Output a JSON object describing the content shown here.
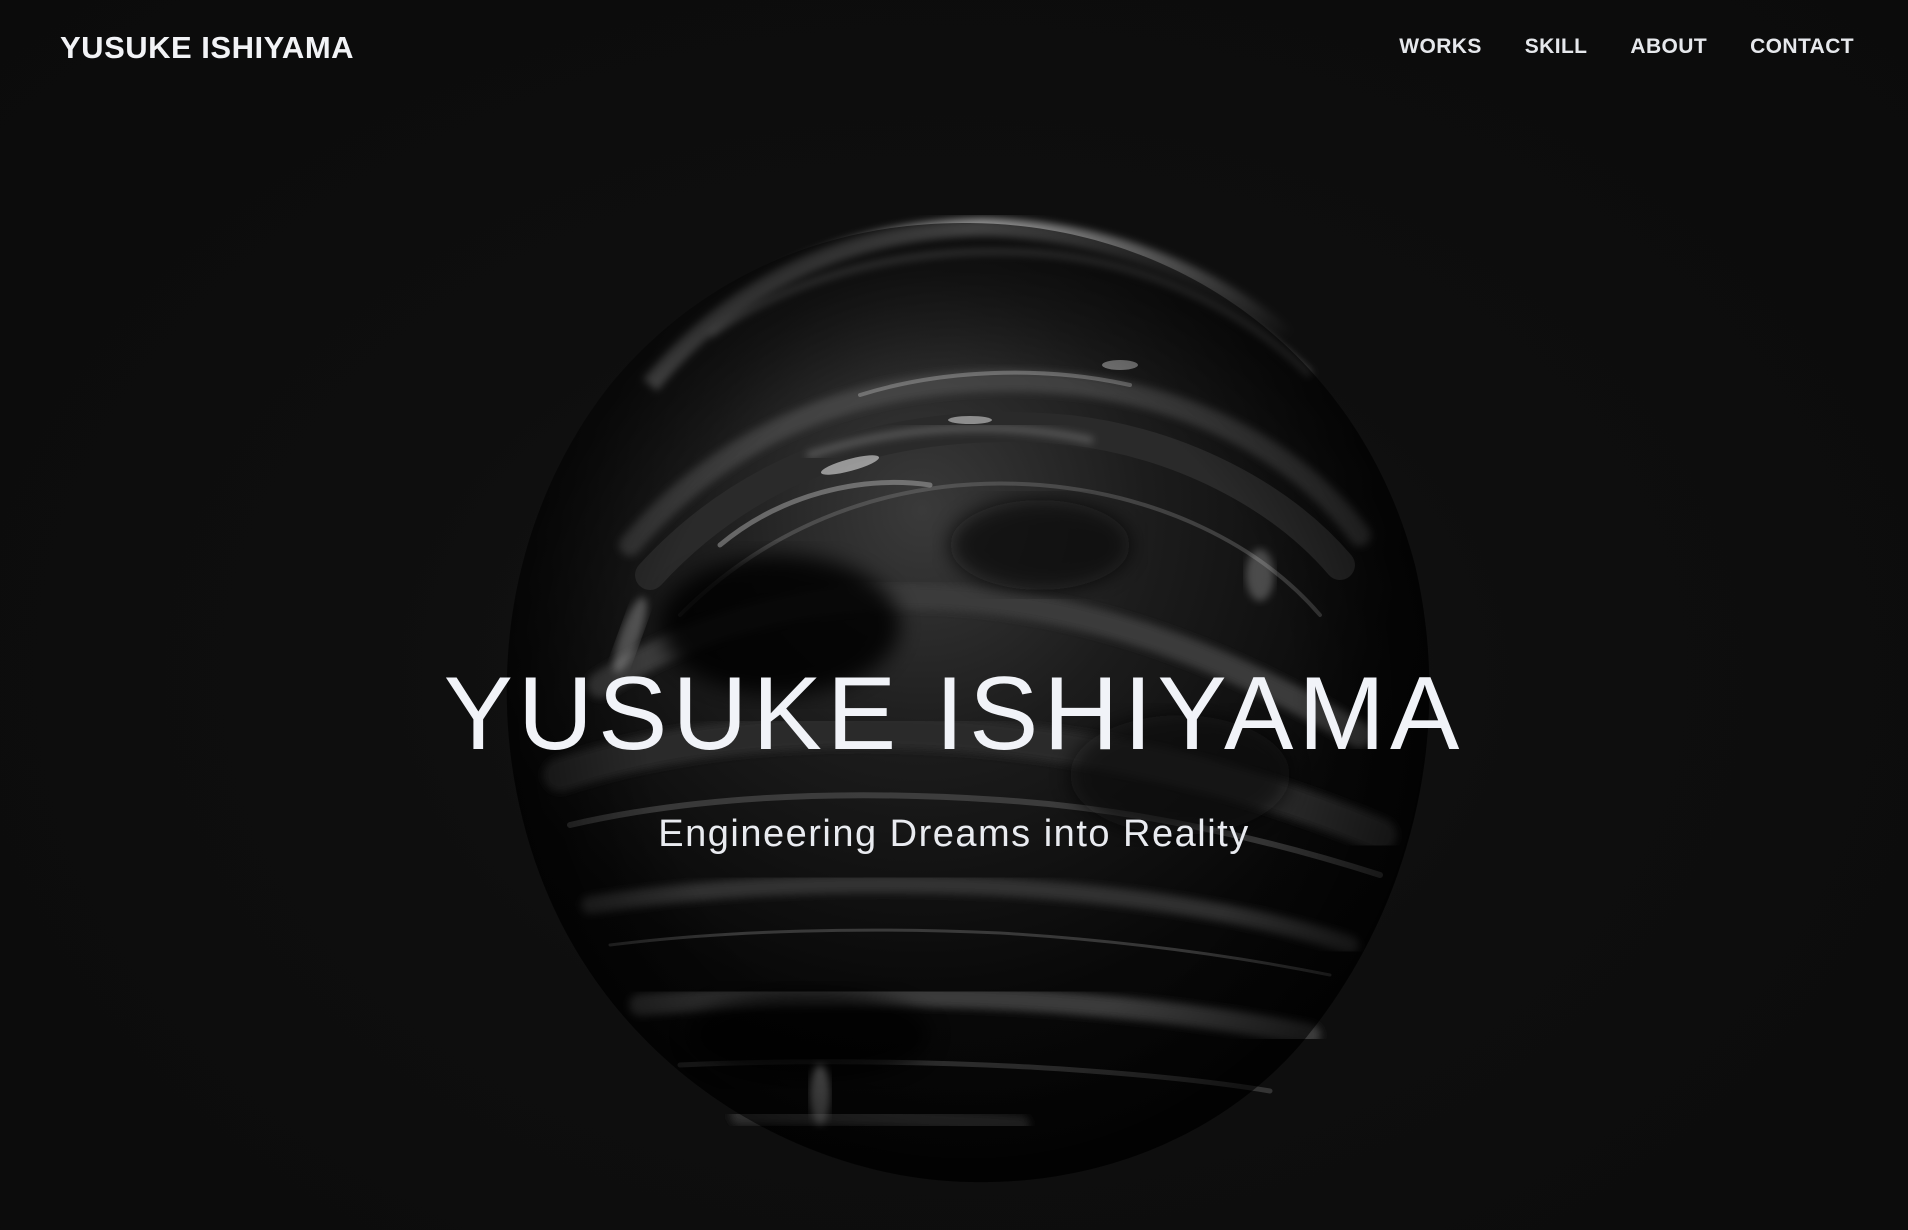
{
  "header": {
    "logo": "YUSUKE ISHIYAMA",
    "nav": [
      {
        "label": "WORKS"
      },
      {
        "label": "SKILL"
      },
      {
        "label": "ABOUT"
      },
      {
        "label": "CONTACT"
      }
    ]
  },
  "hero": {
    "title": "YUSUKE ISHIYAMA",
    "subtitle": "Engineering Dreams into Reality"
  },
  "colors": {
    "background": "#0d0d0d",
    "text": "#f1f3f8"
  },
  "visual": {
    "object": "abstract-black-glossy-sphere"
  }
}
